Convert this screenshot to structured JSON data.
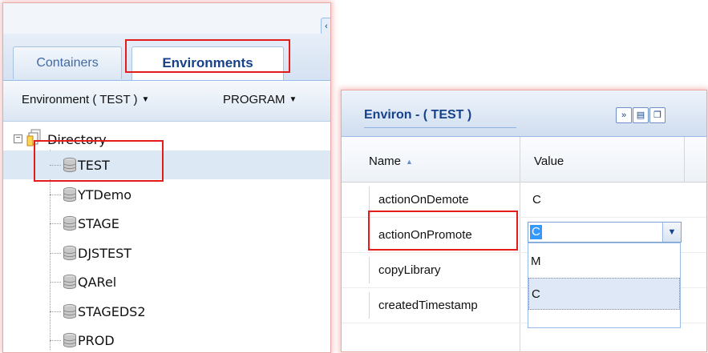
{
  "left_panel": {
    "collapse_glyph": "‹",
    "tabs": [
      {
        "label": "Containers"
      },
      {
        "label": "Environments"
      }
    ],
    "toolbar": {
      "environment_label": "Environment ( TEST )",
      "program_label": "PROGRAM",
      "dropdown_arrow": "▼"
    },
    "tree": {
      "toggle": "−",
      "root_label": "Directory",
      "items": [
        {
          "label": "TEST"
        },
        {
          "label": "YTDemo"
        },
        {
          "label": "STAGE"
        },
        {
          "label": "DJSTEST"
        },
        {
          "label": "QARel"
        },
        {
          "label": "STAGEDS2"
        },
        {
          "label": "PROD"
        }
      ]
    }
  },
  "right_panel": {
    "title": "Environ - ( TEST )",
    "header_buttons": [
      "»",
      "▤",
      "❐"
    ],
    "columns": {
      "name": "Name",
      "value": "Value",
      "sort_glyph": "▲"
    },
    "rows": [
      {
        "name": "actionOnDemote",
        "value": "C"
      },
      {
        "name": "actionOnPromote",
        "value": ""
      },
      {
        "name": "copyLibrary",
        "value": ""
      },
      {
        "name": "createdTimestamp",
        "value": ""
      }
    ],
    "combo": {
      "value": "C",
      "trigger": "▼"
    },
    "dropdown_options": [
      {
        "label": "M"
      },
      {
        "label": "C"
      }
    ]
  },
  "colors": {
    "highlight_red": "#e31b1b",
    "ext_blue": "#15428b",
    "selection_blue": "#3399ff"
  }
}
